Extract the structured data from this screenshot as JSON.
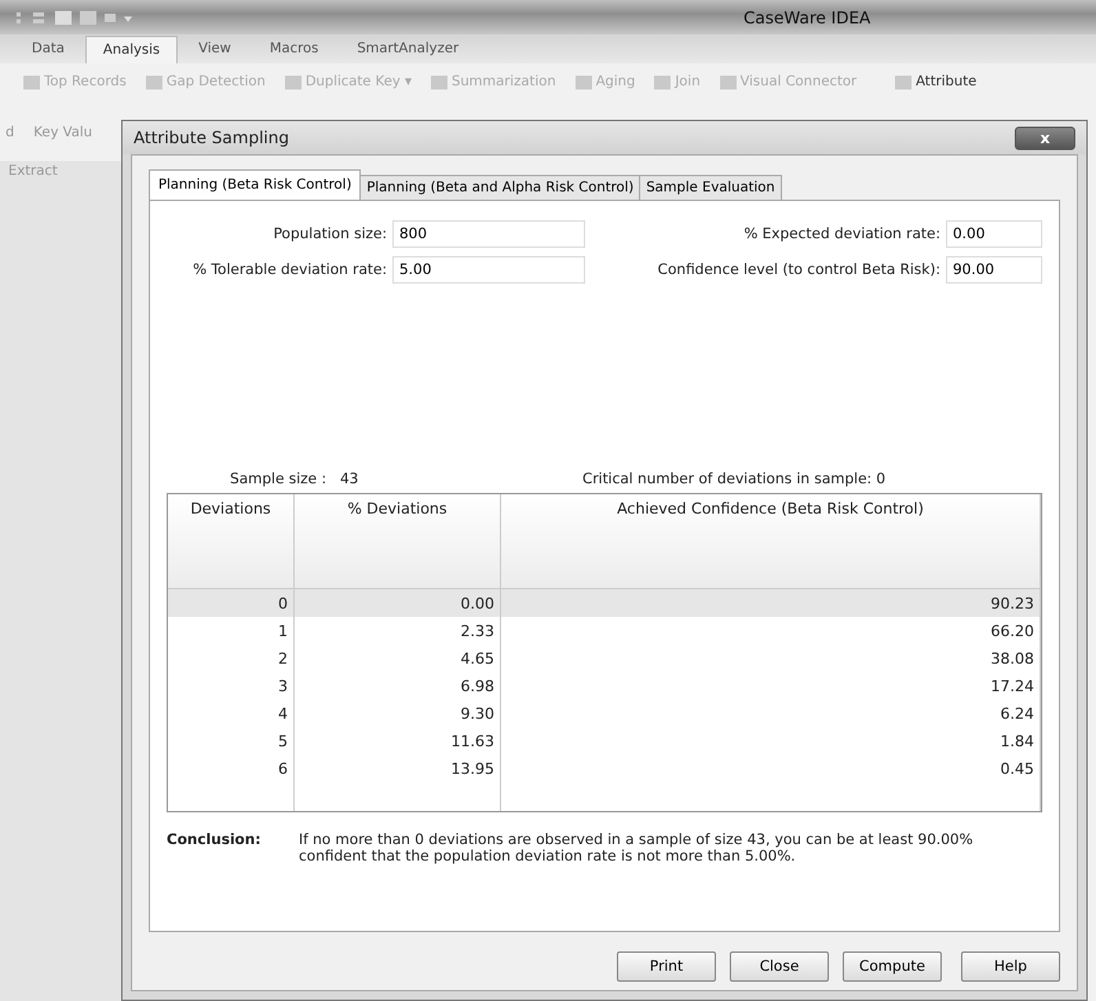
{
  "app": {
    "title": "CaseWare IDEA",
    "menu_tabs": [
      {
        "label": "Data",
        "selected": false
      },
      {
        "label": "Analysis",
        "selected": true
      },
      {
        "label": "View",
        "selected": false
      },
      {
        "label": "Macros",
        "selected": false
      },
      {
        "label": "SmartAnalyzer",
        "selected": false
      }
    ],
    "ribbon_row1": [
      "Top Records",
      "Gap Detection",
      "Duplicate Key ▾",
      "Summarization",
      "Aging",
      "Join",
      "Visual Connector",
      "Attribute"
    ],
    "ribbon_row2": [
      "d",
      "Key Valu"
    ],
    "group_label": "Extract"
  },
  "dialog": {
    "title": "Attribute Sampling",
    "close": "x",
    "tabs": [
      {
        "label": "Planning (Beta Risk Control)",
        "selected": true
      },
      {
        "label": "Planning (Beta and Alpha Risk Control)",
        "selected": false
      },
      {
        "label": "Sample Evaluation",
        "selected": false
      }
    ],
    "fields_left": [
      {
        "label": "Population size:",
        "value": "800"
      },
      {
        "label": "% Tolerable deviation rate:",
        "value": "5.00"
      }
    ],
    "fields_right": [
      {
        "label": "% Expected deviation rate:",
        "value": "0.00"
      },
      {
        "label": "Confidence level (to control Beta Risk):",
        "value": "90.00"
      }
    ],
    "sample_size_label": "Sample size :",
    "sample_size": "43",
    "critical": "Critical number of deviations in sample: 0",
    "table": {
      "columns": [
        "Deviations",
        "% Deviations",
        "Achieved Confidence (Beta Risk Control)"
      ],
      "rows": [
        {
          "cells": [
            "0",
            "0.00",
            "90.23"
          ],
          "selected": true
        },
        {
          "cells": [
            "1",
            "2.33",
            "66.20"
          ],
          "selected": false
        },
        {
          "cells": [
            "2",
            "4.65",
            "38.08"
          ],
          "selected": false
        },
        {
          "cells": [
            "3",
            "6.98",
            "17.24"
          ],
          "selected": false
        },
        {
          "cells": [
            "4",
            "9.30",
            "6.24"
          ],
          "selected": false
        },
        {
          "cells": [
            "5",
            "11.63",
            "1.84"
          ],
          "selected": false
        },
        {
          "cells": [
            "6",
            "13.95",
            "0.45"
          ],
          "selected": false
        }
      ]
    },
    "conclusion_label": "Conclusion:",
    "conclusion": "If no more than 0 deviations are observed in a sample of size 43, you can be at least 90.00% confident that the population deviation rate is not more than 5.00%.",
    "buttons": [
      "Print",
      "Close",
      "Compute",
      "Help"
    ]
  }
}
